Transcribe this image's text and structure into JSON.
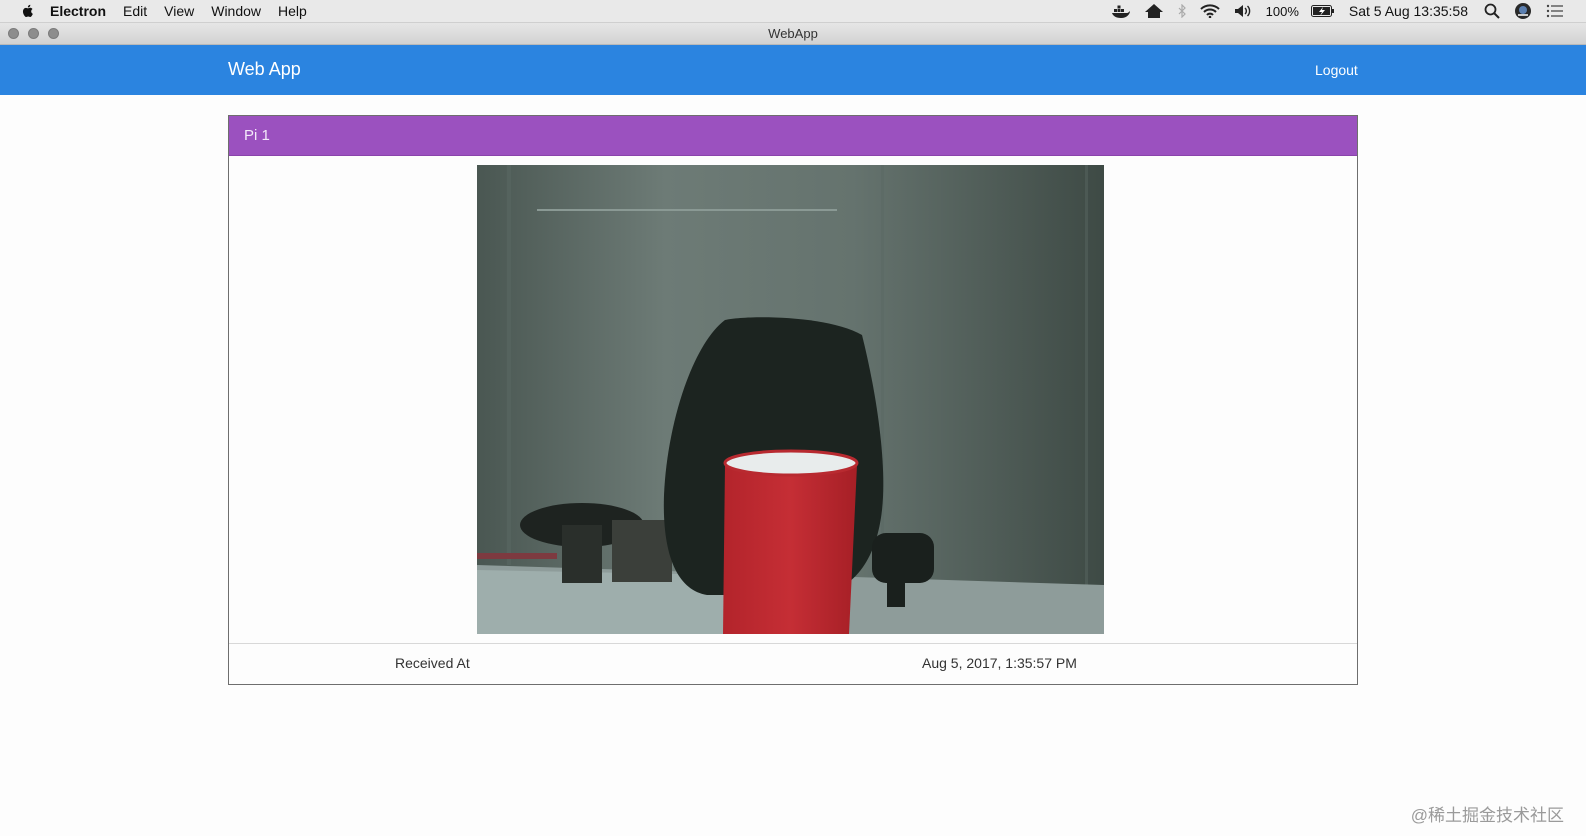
{
  "menubar": {
    "app_name": "Electron",
    "items": [
      "Edit",
      "View",
      "Window",
      "Help"
    ],
    "battery": "100%",
    "datetime": "Sat 5 Aug  13:35:58"
  },
  "window": {
    "title": "WebApp"
  },
  "navbar": {
    "brand": "Web App",
    "logout": "Logout"
  },
  "panel": {
    "title": "Pi 1",
    "received_label": "Received At",
    "received_value": "Aug 5, 2017, 1:35:57 PM"
  },
  "watermark": "@稀土掘金技术社区",
  "colors": {
    "navbar": "#2b84e0",
    "panel_heading": "#9b51bf",
    "cup": "#c1272d"
  }
}
